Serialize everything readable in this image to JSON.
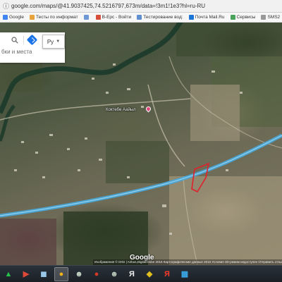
{
  "browser": {
    "url": "google.com/maps/@41.9037425,74.5216797,673m/data=!3m1!1e3?hl=ru-RU",
    "bookmarks": [
      {
        "label": "Google",
        "color": "#4285f4"
      },
      {
        "label": "Тесты по информат",
        "color": "#e8a33d"
      },
      {
        "label": "",
        "color": "#6d9ad4"
      },
      {
        "label": "В-Ерс - Войти",
        "color": "#d84e3c"
      },
      {
        "label": "Тестирование вод:",
        "color": "#5f8fd0"
      },
      {
        "label": "Почта Mail.Ru",
        "color": "#1f74d8"
      },
      {
        "label": "Сервисы",
        "color": "#4aa35a"
      },
      {
        "label": "SMS2",
        "color": "#999999"
      }
    ]
  },
  "maps": {
    "search_text": "бки и места",
    "language": "Ру",
    "pin_label": "Коктөбө Аайыл",
    "logo": "Google",
    "attribution": "Изображения © DIGI | Airbus,DigitalGlobe 2016 Картографические данные 2016   Условия   3D-режим недоступен   Отправить отзыв   100 м"
  },
  "colors": {
    "road": "#4aa8d8",
    "area_outline": "#e0202a",
    "river": "#1c3a2a"
  },
  "taskbar": {
    "items": [
      {
        "name": "start-button",
        "glyph": "▲",
        "color": "#27c24c",
        "active": false
      },
      {
        "name": "media-player-icon",
        "glyph": "▶",
        "color": "#e04838",
        "active": false
      },
      {
        "name": "photo-viewer-icon",
        "glyph": "◼",
        "color": "#9ac8e8",
        "active": false
      },
      {
        "name": "chrome-icon",
        "glyph": "●",
        "color": "#f2b21b",
        "active": true
      },
      {
        "name": "alien-app-icon",
        "glyph": "☻",
        "color": "#c8d8c8",
        "active": false
      },
      {
        "name": "record-app-icon",
        "glyph": "●",
        "color": "#d83a2a",
        "active": false
      },
      {
        "name": "alien-app-2-icon",
        "glyph": "☻",
        "color": "#b8c8b8",
        "active": false
      },
      {
        "name": "yandex-browser-icon",
        "glyph": "Я",
        "color": "#f0f0f0",
        "active": false
      },
      {
        "name": "shield-app-icon",
        "glyph": "◆",
        "color": "#e0c020",
        "active": false
      },
      {
        "name": "yandex-icon",
        "glyph": "Я",
        "color": "#ff3a2a",
        "active": false
      },
      {
        "name": "task-manager-icon",
        "glyph": "▦",
        "color": "#3aa8e8",
        "active": false
      }
    ]
  }
}
